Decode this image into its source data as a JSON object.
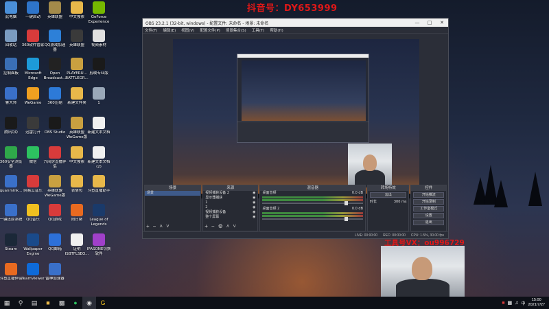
{
  "watermark_top": "抖音号：DY653999",
  "watermark_vx": "工具号VX：ou996729",
  "desktop_icons": [
    {
      "label": "此电脑",
      "icon": "computer-icon",
      "color": "#4a8fd9"
    },
    {
      "label": "一键启动",
      "icon": "app-icon",
      "color": "#2e74c9"
    },
    {
      "label": "英雄联盟",
      "icon": "game-icon",
      "color": "#a38a4a"
    },
    {
      "label": "中文搜索",
      "icon": "folder-icon",
      "color": "#e8b84a"
    },
    {
      "label": "GeForce Experience",
      "icon": "nvidia-icon",
      "color": "#76b900"
    },
    {
      "label": "回收站",
      "icon": "recycle-bin-icon",
      "color": "#7a9bc0"
    },
    {
      "label": "360软件管家",
      "icon": "app-icon",
      "color": "#d83b3b"
    },
    {
      "label": "QQ游戏加速器",
      "icon": "app-icon",
      "color": "#2d80d8"
    },
    {
      "label": "英雄联盟",
      "icon": "game-icon",
      "color": "#3a3a3a"
    },
    {
      "label": "视频素材",
      "icon": "file-icon",
      "color": "#e0e0e0"
    },
    {
      "label": "控制面板",
      "icon": "control-panel-icon",
      "color": "#3a6fb5"
    },
    {
      "label": "Microsoft Edge",
      "icon": "edge-icon",
      "color": "#1d9ad8"
    },
    {
      "label": "Open Broadcast...",
      "icon": "app-icon",
      "color": "#222222"
    },
    {
      "label": "PLAYERU... BATTLEGR...",
      "icon": "game-icon",
      "color": "#c9a040"
    },
    {
      "label": "剪映专业版",
      "icon": "app-icon",
      "color": "#1a1a1a"
    },
    {
      "label": "鲁大师",
      "icon": "app-icon",
      "color": "#3a70c9"
    },
    {
      "label": "WeGame",
      "icon": "app-icon",
      "color": "#f0a020"
    },
    {
      "label": "360压缩",
      "icon": "app-icon",
      "color": "#2d7ad8"
    },
    {
      "label": "新建文件夹",
      "icon": "folder-icon",
      "color": "#e8b84a"
    },
    {
      "label": "1",
      "icon": "file-icon",
      "color": "#9aa8b8"
    },
    {
      "label": "腾讯QQ",
      "icon": "qq-icon",
      "color": "#1a1a1a"
    },
    {
      "label": "迅雷打开",
      "icon": "app-icon",
      "color": "#3a3a3a"
    },
    {
      "label": "OBS Studio",
      "icon": "obs-icon",
      "color": "#1a1a1a"
    },
    {
      "label": "英雄联盟 WeGame版",
      "icon": "game-icon",
      "color": "#c9a040"
    },
    {
      "label": "新建文本文档",
      "icon": "file-icon",
      "color": "#f0f0f0"
    },
    {
      "label": "360安全浏览器",
      "icon": "app-icon",
      "color": "#2fa84a"
    },
    {
      "label": "微信",
      "icon": "wechat-icon",
      "color": "#2dc160"
    },
    {
      "label": "六间房直播伴侣",
      "icon": "app-icon",
      "color": "#d83b3b"
    },
    {
      "label": "中文搜索",
      "icon": "folder-icon",
      "color": "#e8b84a"
    },
    {
      "label": "新建文本文档 (2)",
      "icon": "file-icon",
      "color": "#f0f0f0"
    },
    {
      "label": "quanmink...",
      "icon": "app-icon",
      "color": "#3a70c9"
    },
    {
      "label": "网易云音乐",
      "icon": "app-icon",
      "color": "#d83b3b"
    },
    {
      "label": "英雄联盟 WeGame版",
      "icon": "game-icon",
      "color": "#c9a040"
    },
    {
      "label": "表情包",
      "icon": "folder-icon",
      "color": "#e8b84a"
    },
    {
      "label": "斗鱼直播助手",
      "icon": "file-icon",
      "color": "#e8b84a"
    },
    {
      "label": "一键还原系统",
      "icon": "app-icon",
      "color": "#3a70c9"
    },
    {
      "label": "QQ音乐",
      "icon": "app-icon",
      "color": "#f0c020"
    },
    {
      "label": "QQ游戏",
      "icon": "app-icon",
      "color": "#d83b3b"
    },
    {
      "label": "向日葵",
      "icon": "app-icon",
      "color": "#e86a20"
    },
    {
      "label": "League of Legends",
      "icon": "game-icon",
      "color": "#1a3a6a"
    },
    {
      "label": "Steam",
      "icon": "steam-icon",
      "color": "#1b2838"
    },
    {
      "label": "Wallpaper Engine",
      "icon": "app-icon",
      "color": "#1a4a8a"
    },
    {
      "label": "QQ邮箱",
      "icon": "app-icon",
      "color": "#2d70d8"
    },
    {
      "label": "证明 ISBTFLSEO...",
      "icon": "file-icon",
      "color": "#f0f0f0"
    },
    {
      "label": "IPASONE切换软件",
      "icon": "app-icon",
      "color": "#a040c9"
    },
    {
      "label": "斗鱼直播伴侣",
      "icon": "app-icon",
      "color": "#e86a20"
    },
    {
      "label": "TeamViewer",
      "icon": "app-icon",
      "color": "#0e6ad8"
    },
    {
      "label": "雷神加速器",
      "icon": "app-icon",
      "color": "#3a70c9"
    }
  ],
  "obs": {
    "title": "OBS 23.2.1 (32-bit, windows) - 配置文件: 未命名 - 场景: 未命名",
    "menu": [
      "文件(F)",
      "编辑(E)",
      "视图(V)",
      "配置文件(P)",
      "场景集合(S)",
      "工具(T)",
      "帮助(H)"
    ],
    "docks": {
      "scenes": {
        "header": "场景",
        "items": [
          "场景"
        ]
      },
      "sources": {
        "header": "来源",
        "items": [
          "视频捕获设备 2",
          "显示器捕获",
          "1",
          "2",
          "视频捕获设备",
          "整个屏幕"
        ]
      },
      "mixer": {
        "header": "混音器",
        "channels": [
          {
            "name": "桌面音频",
            "db": "0.0 dB"
          },
          {
            "name": "桌面音频 2",
            "db": "0.0 dB"
          }
        ]
      },
      "transitions": {
        "header": "转场特效",
        "type": "淡出",
        "duration_label": "时长",
        "duration": "300 ms"
      },
      "controls": {
        "header": "控件",
        "buttons": [
          "开始推流",
          "开始录制",
          "工作室模式",
          "设置",
          "退出"
        ]
      }
    },
    "status": {
      "live": "LIVE: 00:00:00",
      "rec": "REC: 00:00:00",
      "cpu": "CPU: 1.5%, 30.00 fps"
    }
  },
  "taskbar": {
    "time": "15:00",
    "date": "2021/7/27"
  }
}
